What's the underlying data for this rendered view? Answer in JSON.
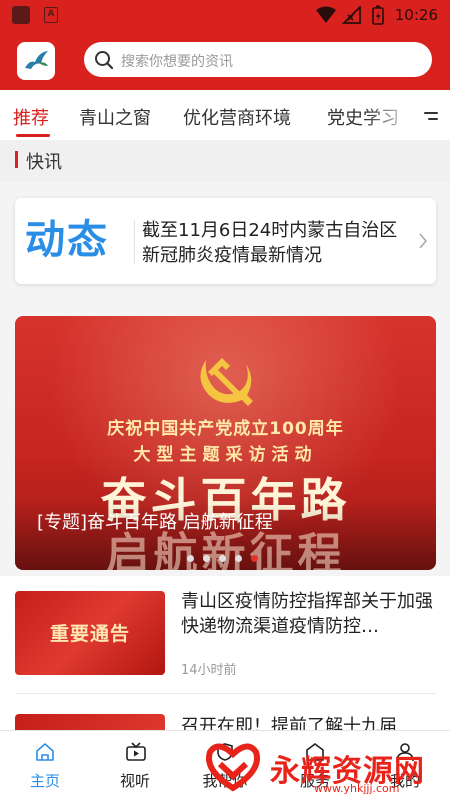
{
  "status_bar": {
    "time": "10:26",
    "a_icon": "A"
  },
  "header": {
    "search_placeholder": "搜索你想要的资讯"
  },
  "tabs": [
    {
      "label": "推荐",
      "active": true
    },
    {
      "label": "青山之窗"
    },
    {
      "label": "优化营商环境"
    },
    {
      "label": "党史学习"
    }
  ],
  "section": {
    "title": "快讯"
  },
  "flash_news": {
    "badge": "动态",
    "text": "截至11月6日24时内蒙古自治区新冠肺炎疫情最新情况"
  },
  "banner": {
    "line1": "庆祝中国共产党成立100周年",
    "line2": "大型主题采访活动",
    "line3": "奋斗百年路",
    "line4": "启航新征程",
    "caption": "[专题]奋斗百年路 启航新征程",
    "dot_count": 5,
    "active_dot": 4
  },
  "list": [
    {
      "thumb_text": "重要通告",
      "title": "青山区疫情防控指挥部关于加强快递物流渠道疫情防控…",
      "time": "14小时前"
    },
    {
      "title": "召开在即！提前了解十九届"
    }
  ],
  "bottom_nav": [
    {
      "label": "主页",
      "icon": "home-icon",
      "active": true
    },
    {
      "label": "视听",
      "icon": "video-icon"
    },
    {
      "label": "我帮你",
      "icon": "help-icon"
    },
    {
      "label": "服务",
      "icon": "service-icon"
    },
    {
      "label": "我的",
      "icon": "profile-icon"
    }
  ],
  "watermark": {
    "text": "永辉资源网",
    "url": "www.yhkjjj.com"
  },
  "colors": {
    "brand_red": "#d9221e",
    "accent_blue": "#2a8ee6"
  }
}
